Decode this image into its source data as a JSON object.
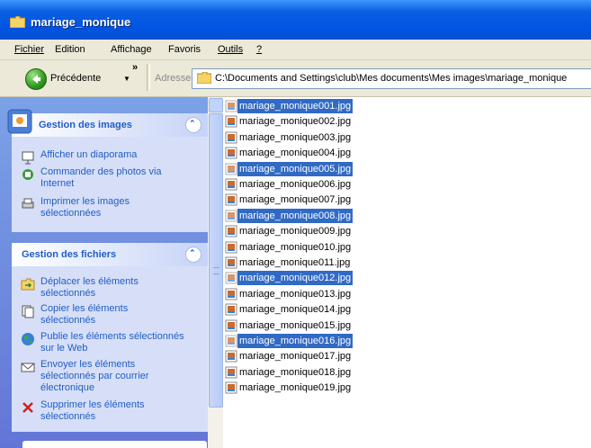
{
  "window": {
    "title": "mariage_monique"
  },
  "menu": {
    "items": [
      {
        "label": "Fichier",
        "accel": "F"
      },
      {
        "label": "Edition",
        "accel": "E"
      },
      {
        "label": "Affichage",
        "accel": "h"
      },
      {
        "label": "Favoris",
        "accel": "v"
      },
      {
        "label": "Outils",
        "accel": "O"
      },
      {
        "label": "?",
        "accel": "?"
      }
    ]
  },
  "toolbar": {
    "back_label": "Précédente",
    "more_chevron": "»",
    "address_label": "Adresse",
    "address_value": "C:\\Documents and Settings\\club\\Mes documents\\Mes images\\mariage_monique"
  },
  "image_tasks": {
    "title": "Gestion des images",
    "items": [
      {
        "label": "Afficher un diaporama",
        "icon": "slideshow-icon"
      },
      {
        "label": "Commander des photos via Internet",
        "icon": "order-photos-icon"
      },
      {
        "label": "Imprimer les images sélectionnées",
        "icon": "printer-icon"
      }
    ]
  },
  "file_tasks": {
    "title": "Gestion des fichiers",
    "items": [
      {
        "label": "Déplacer les éléments sélectionnés",
        "icon": "move-icon"
      },
      {
        "label": "Copier les éléments sélectionnés",
        "icon": "copy-icon"
      },
      {
        "label": "Publie les éléments sélectionnés sur le Web",
        "icon": "globe-icon"
      },
      {
        "label": "Envoyer les éléments sélectionnés par courrier électronique",
        "icon": "email-icon"
      },
      {
        "label": "Supprimer les éléments sélectionnés",
        "icon": "delete-icon"
      }
    ]
  },
  "files": [
    {
      "name": "mariage_monique001.jpg",
      "selected": true
    },
    {
      "name": "mariage_monique002.jpg",
      "selected": false
    },
    {
      "name": "mariage_monique003.jpg",
      "selected": false
    },
    {
      "name": "mariage_monique004.jpg",
      "selected": false
    },
    {
      "name": "mariage_monique005.jpg",
      "selected": true
    },
    {
      "name": "mariage_monique006.jpg",
      "selected": false
    },
    {
      "name": "mariage_monique007.jpg",
      "selected": false
    },
    {
      "name": "mariage_monique008.jpg",
      "selected": true
    },
    {
      "name": "mariage_monique009.jpg",
      "selected": false
    },
    {
      "name": "mariage_monique010.jpg",
      "selected": false
    },
    {
      "name": "mariage_monique011.jpg",
      "selected": false
    },
    {
      "name": "mariage_monique012.jpg",
      "selected": true
    },
    {
      "name": "mariage_monique013.jpg",
      "selected": false
    },
    {
      "name": "mariage_monique014.jpg",
      "selected": false
    },
    {
      "name": "mariage_monique015.jpg",
      "selected": false
    },
    {
      "name": "mariage_monique016.jpg",
      "selected": true
    },
    {
      "name": "mariage_monique017.jpg",
      "selected": false
    },
    {
      "name": "mariage_monique018.jpg",
      "selected": false
    },
    {
      "name": "mariage_monique019.jpg",
      "selected": false
    }
  ],
  "colors": {
    "title_bar": "#0054e3",
    "selection": "#316ac5",
    "task_link": "#215dc6",
    "task_pane": "#7ba2e7"
  }
}
